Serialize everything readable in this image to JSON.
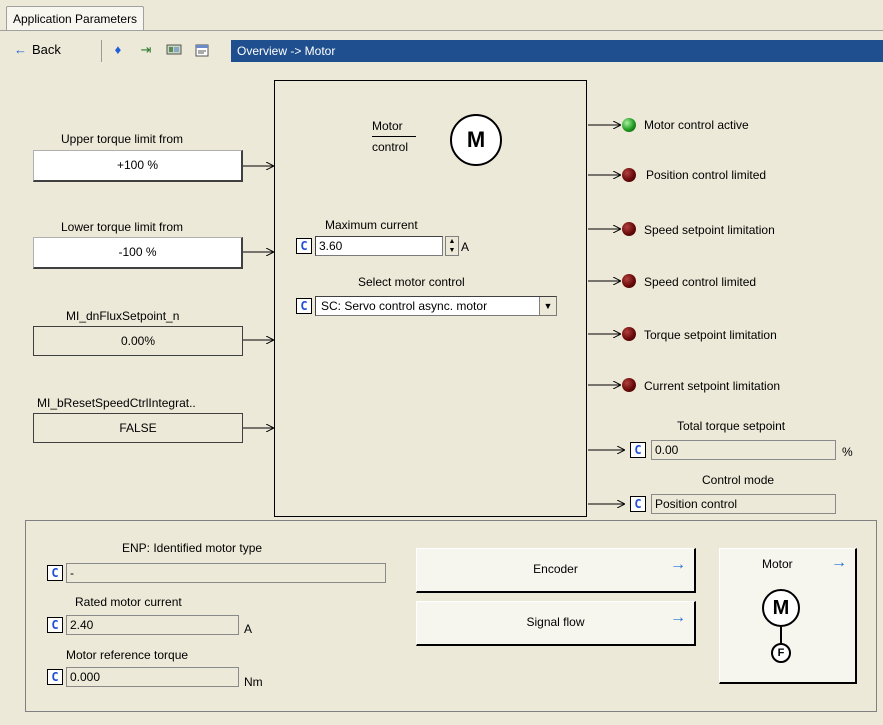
{
  "tab": {
    "label": "Application Parameters"
  },
  "toolbar": {
    "back_label": "Back",
    "breadcrumb": "Overview -> Motor"
  },
  "inputs": [
    {
      "label": "Upper torque limit from",
      "value": "+100 %"
    },
    {
      "label": "Lower torque limit from",
      "value": "-100 %"
    },
    {
      "label": "MI_dnFluxSetpoint_n",
      "value": "0.00%"
    },
    {
      "label": "MI_bResetSpeedCtrlIntegrat..",
      "value": "FALSE"
    }
  ],
  "center": {
    "motor_label": "Motor",
    "control_label": "control",
    "motor_symbol": "M",
    "max_current_label": "Maximum current",
    "max_current_value": "3.60",
    "max_current_unit": "A",
    "select_label": "Select motor control",
    "select_value": "SC: Servo control async. motor",
    "c_label": "C"
  },
  "status": [
    {
      "label": "Motor control active",
      "state": "on"
    },
    {
      "label": "Position control limited",
      "state": "off"
    },
    {
      "label": "Speed setpoint limitation",
      "state": "off"
    },
    {
      "label": "Speed control limited",
      "state": "off"
    },
    {
      "label": "Torque setpoint limitation",
      "state": "off"
    },
    {
      "label": "Current setpoint limitation",
      "state": "off"
    }
  ],
  "outputs": {
    "total_torque_label": "Total torque setpoint",
    "total_torque_value": "0.00",
    "total_torque_unit": "%",
    "control_mode_label": "Control mode",
    "control_mode_value": "Position control"
  },
  "bottom": {
    "enp_label": "ENP: Identified motor type",
    "enp_value": "-",
    "rated_label": "Rated motor current",
    "rated_value": "2.40",
    "rated_unit": "A",
    "ref_label": "Motor reference torque",
    "ref_value": "0.000",
    "ref_unit": "Nm",
    "encoder_btn": "Encoder",
    "signal_btn": "Signal flow",
    "motor_btn": "Motor",
    "motor_symbol": "M",
    "feedback_symbol": "F"
  },
  "colors": {
    "breadcrumb_bg": "#1f4f8e",
    "led_on": "#1f9a1f",
    "led_off": "#6a0a0a",
    "c_button": "#1f4fd6"
  }
}
